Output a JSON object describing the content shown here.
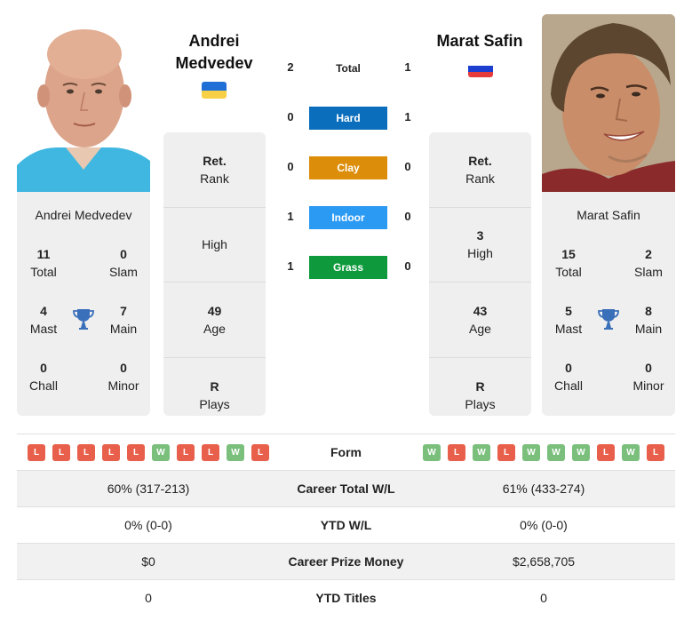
{
  "colors": {
    "hard": "#0a6ebd",
    "clay": "#dc8d0a",
    "indoor": "#2b9af3",
    "grass": "#0e9a3c",
    "win": "#7bbf7d",
    "loss": "#e8604c",
    "trophy": "#3a6fba"
  },
  "players": {
    "left": {
      "name": "Andrei Medvedev",
      "name_line1": "Andrei",
      "name_line2": "Medvedev",
      "flag": "ukraine-flag",
      "flag_colors": [
        "#1f6fd6",
        "#f7d046"
      ],
      "card": {
        "total": {
          "value": "11",
          "label": "Total"
        },
        "slam": {
          "value": "0",
          "label": "Slam"
        },
        "mast": {
          "value": "4",
          "label": "Mast"
        },
        "main": {
          "value": "7",
          "label": "Main"
        },
        "chall": {
          "value": "0",
          "label": "Chall"
        },
        "minor": {
          "value": "0",
          "label": "Minor"
        }
      },
      "stats": {
        "rank": {
          "value": "Ret.",
          "label": "Rank"
        },
        "high": {
          "value": "",
          "label": "High"
        },
        "age": {
          "value": "49",
          "label": "Age"
        },
        "plays": {
          "value": "R",
          "label": "Plays"
        }
      }
    },
    "right": {
      "name": "Marat Safin",
      "flag": "russia-flag",
      "flag_colors": [
        "#ffffff",
        "#1c3fd1",
        "#e53b3b"
      ],
      "card": {
        "total": {
          "value": "15",
          "label": "Total"
        },
        "slam": {
          "value": "2",
          "label": "Slam"
        },
        "mast": {
          "value": "5",
          "label": "Mast"
        },
        "main": {
          "value": "8",
          "label": "Main"
        },
        "chall": {
          "value": "0",
          "label": "Chall"
        },
        "minor": {
          "value": "0",
          "label": "Minor"
        }
      },
      "stats": {
        "rank": {
          "value": "Ret.",
          "label": "Rank"
        },
        "high": {
          "value": "3",
          "label": "High"
        },
        "age": {
          "value": "43",
          "label": "Age"
        },
        "plays": {
          "value": "R",
          "label": "Plays"
        }
      }
    }
  },
  "h2h": [
    {
      "label": "Total",
      "left": "2",
      "right": "1",
      "surface": "total"
    },
    {
      "label": "Hard",
      "left": "0",
      "right": "1",
      "surface": "hard"
    },
    {
      "label": "Clay",
      "left": "0",
      "right": "0",
      "surface": "clay"
    },
    {
      "label": "Indoor",
      "left": "1",
      "right": "0",
      "surface": "indoor"
    },
    {
      "label": "Grass",
      "left": "1",
      "right": "0",
      "surface": "grass"
    }
  ],
  "comparison": {
    "form": {
      "label": "Form",
      "left": [
        "L",
        "L",
        "L",
        "L",
        "L",
        "W",
        "L",
        "L",
        "W",
        "L"
      ],
      "right": [
        "W",
        "L",
        "W",
        "L",
        "W",
        "W",
        "W",
        "L",
        "W",
        "L"
      ]
    },
    "rows": [
      {
        "label": "Career Total W/L",
        "left": "60% (317-213)",
        "right": "61% (433-274)"
      },
      {
        "label": "YTD W/L",
        "left": "0% (0-0)",
        "right": "0% (0-0)"
      },
      {
        "label": "Career Prize Money",
        "left": "$0",
        "right": "$2,658,705"
      },
      {
        "label": "YTD Titles",
        "left": "0",
        "right": "0"
      }
    ]
  }
}
